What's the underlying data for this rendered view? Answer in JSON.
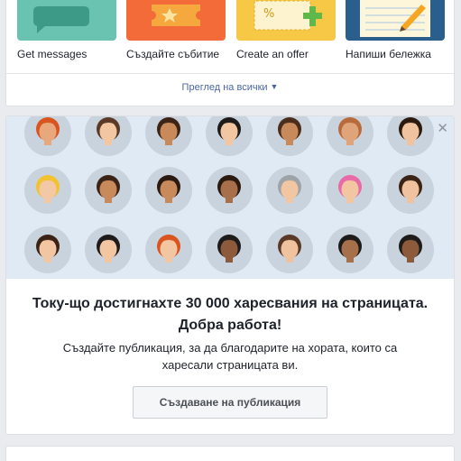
{
  "actions": {
    "items": [
      {
        "label": "Get messages",
        "thumb_color": "#6ac3b0",
        "icon": "chat-bubble-icon"
      },
      {
        "label": "Създайте събитие",
        "thumb_color": "#f26b38",
        "icon": "ticket-icon"
      },
      {
        "label": "Create an offer",
        "thumb_color": "#f7c845",
        "icon": "coupon-icon"
      },
      {
        "label": "Напиши бележка",
        "thumb_color": "#2a5e8c",
        "icon": "notepad-pencil-icon"
      }
    ],
    "see_all_label": "Преглед на всички",
    "see_all_icon": "chevron-down-icon"
  },
  "milestone": {
    "close_icon": "close-icon",
    "banner_color": "#dfeaf4",
    "title_line1": "Току-що достигнахте 30 000 харесвания на страницата.",
    "title_line2": "Добра работа!",
    "description": "Създайте публикация, за да благодарите на хората, които са харесали страницата ви.",
    "button_label": "Създаване на публикация"
  },
  "colors": {
    "link": "#4b67a1",
    "text": "#1d2129",
    "page_background": "#e9ebee"
  }
}
